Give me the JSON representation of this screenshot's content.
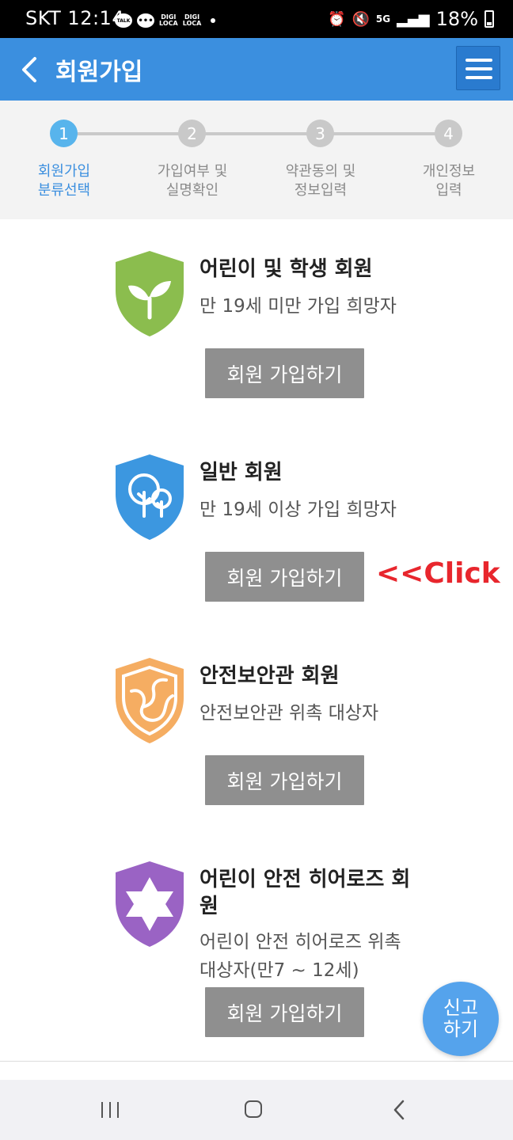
{
  "status_bar": {
    "carrier": "SKT",
    "time": "12:14",
    "talk_label": "TALK",
    "digi1": "DIGI\nLOCA",
    "digi2": "DIGI\nLOCA",
    "network": "5G",
    "battery": "18%"
  },
  "header": {
    "title": "회원가입"
  },
  "steps": [
    {
      "number": "1",
      "label": "회원가입\n분류선택"
    },
    {
      "number": "2",
      "label": "가입여부 및\n실명확인"
    },
    {
      "number": "3",
      "label": "약관동의 및\n정보입력"
    },
    {
      "number": "4",
      "label": "개인정보\n입력"
    }
  ],
  "cards": [
    {
      "title": "어린이 및 학생 회원",
      "desc": "만 19세 미만 가입 희망자",
      "button": "회원 가입하기"
    },
    {
      "title": "일반 회원",
      "desc": "만 19세 이상 가입 희망자",
      "button": "회원 가입하기"
    },
    {
      "title": "안전보안관 회원",
      "desc": "안전보안관 위촉 대상자",
      "button": "회원 가입하기"
    },
    {
      "title": "어린이 안전 히어로즈 회원",
      "desc": "어린이 안전 히어로즈 위촉 대상자(만7 ~ 12세)",
      "button": "회원 가입하기"
    }
  ],
  "annotation": "<<Click",
  "report_button": "신고\n하기",
  "colors": {
    "header": "#3b8fdf",
    "step_active": "#58b4ec",
    "shield_green": "#8bbd4e",
    "shield_blue": "#3c97e0",
    "shield_orange": "#f5ad62",
    "shield_purple": "#9a63c4",
    "button_gray": "#8f8f8f",
    "annotation_red": "#e8262d"
  },
  "icons": {
    "back": "chevron-left-icon",
    "menu": "hamburger-icon",
    "card1": "sprout-shield-icon",
    "card2": "tree-shield-icon",
    "card3": "guard-shield-icon",
    "card4": "star-shield-icon"
  }
}
